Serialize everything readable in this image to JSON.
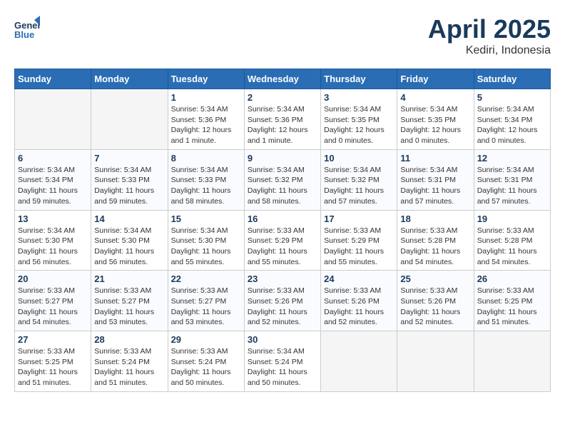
{
  "header": {
    "logo_line1": "General",
    "logo_line2": "Blue",
    "month_year": "April 2025",
    "location": "Kediri, Indonesia"
  },
  "weekdays": [
    "Sunday",
    "Monday",
    "Tuesday",
    "Wednesday",
    "Thursday",
    "Friday",
    "Saturday"
  ],
  "weeks": [
    [
      {
        "day": "",
        "info": ""
      },
      {
        "day": "",
        "info": ""
      },
      {
        "day": "1",
        "info": "Sunrise: 5:34 AM\nSunset: 5:36 PM\nDaylight: 12 hours\nand 1 minute."
      },
      {
        "day": "2",
        "info": "Sunrise: 5:34 AM\nSunset: 5:36 PM\nDaylight: 12 hours\nand 1 minute."
      },
      {
        "day": "3",
        "info": "Sunrise: 5:34 AM\nSunset: 5:35 PM\nDaylight: 12 hours\nand 0 minutes."
      },
      {
        "day": "4",
        "info": "Sunrise: 5:34 AM\nSunset: 5:35 PM\nDaylight: 12 hours\nand 0 minutes."
      },
      {
        "day": "5",
        "info": "Sunrise: 5:34 AM\nSunset: 5:34 PM\nDaylight: 12 hours\nand 0 minutes."
      }
    ],
    [
      {
        "day": "6",
        "info": "Sunrise: 5:34 AM\nSunset: 5:34 PM\nDaylight: 11 hours\nand 59 minutes."
      },
      {
        "day": "7",
        "info": "Sunrise: 5:34 AM\nSunset: 5:33 PM\nDaylight: 11 hours\nand 59 minutes."
      },
      {
        "day": "8",
        "info": "Sunrise: 5:34 AM\nSunset: 5:33 PM\nDaylight: 11 hours\nand 58 minutes."
      },
      {
        "day": "9",
        "info": "Sunrise: 5:34 AM\nSunset: 5:32 PM\nDaylight: 11 hours\nand 58 minutes."
      },
      {
        "day": "10",
        "info": "Sunrise: 5:34 AM\nSunset: 5:32 PM\nDaylight: 11 hours\nand 57 minutes."
      },
      {
        "day": "11",
        "info": "Sunrise: 5:34 AM\nSunset: 5:31 PM\nDaylight: 11 hours\nand 57 minutes."
      },
      {
        "day": "12",
        "info": "Sunrise: 5:34 AM\nSunset: 5:31 PM\nDaylight: 11 hours\nand 57 minutes."
      }
    ],
    [
      {
        "day": "13",
        "info": "Sunrise: 5:34 AM\nSunset: 5:30 PM\nDaylight: 11 hours\nand 56 minutes."
      },
      {
        "day": "14",
        "info": "Sunrise: 5:34 AM\nSunset: 5:30 PM\nDaylight: 11 hours\nand 56 minutes."
      },
      {
        "day": "15",
        "info": "Sunrise: 5:34 AM\nSunset: 5:30 PM\nDaylight: 11 hours\nand 55 minutes."
      },
      {
        "day": "16",
        "info": "Sunrise: 5:33 AM\nSunset: 5:29 PM\nDaylight: 11 hours\nand 55 minutes."
      },
      {
        "day": "17",
        "info": "Sunrise: 5:33 AM\nSunset: 5:29 PM\nDaylight: 11 hours\nand 55 minutes."
      },
      {
        "day": "18",
        "info": "Sunrise: 5:33 AM\nSunset: 5:28 PM\nDaylight: 11 hours\nand 54 minutes."
      },
      {
        "day": "19",
        "info": "Sunrise: 5:33 AM\nSunset: 5:28 PM\nDaylight: 11 hours\nand 54 minutes."
      }
    ],
    [
      {
        "day": "20",
        "info": "Sunrise: 5:33 AM\nSunset: 5:27 PM\nDaylight: 11 hours\nand 54 minutes."
      },
      {
        "day": "21",
        "info": "Sunrise: 5:33 AM\nSunset: 5:27 PM\nDaylight: 11 hours\nand 53 minutes."
      },
      {
        "day": "22",
        "info": "Sunrise: 5:33 AM\nSunset: 5:27 PM\nDaylight: 11 hours\nand 53 minutes."
      },
      {
        "day": "23",
        "info": "Sunrise: 5:33 AM\nSunset: 5:26 PM\nDaylight: 11 hours\nand 52 minutes."
      },
      {
        "day": "24",
        "info": "Sunrise: 5:33 AM\nSunset: 5:26 PM\nDaylight: 11 hours\nand 52 minutes."
      },
      {
        "day": "25",
        "info": "Sunrise: 5:33 AM\nSunset: 5:26 PM\nDaylight: 11 hours\nand 52 minutes."
      },
      {
        "day": "26",
        "info": "Sunrise: 5:33 AM\nSunset: 5:25 PM\nDaylight: 11 hours\nand 51 minutes."
      }
    ],
    [
      {
        "day": "27",
        "info": "Sunrise: 5:33 AM\nSunset: 5:25 PM\nDaylight: 11 hours\nand 51 minutes."
      },
      {
        "day": "28",
        "info": "Sunrise: 5:33 AM\nSunset: 5:24 PM\nDaylight: 11 hours\nand 51 minutes."
      },
      {
        "day": "29",
        "info": "Sunrise: 5:33 AM\nSunset: 5:24 PM\nDaylight: 11 hours\nand 50 minutes."
      },
      {
        "day": "30",
        "info": "Sunrise: 5:34 AM\nSunset: 5:24 PM\nDaylight: 11 hours\nand 50 minutes."
      },
      {
        "day": "",
        "info": ""
      },
      {
        "day": "",
        "info": ""
      },
      {
        "day": "",
        "info": ""
      }
    ]
  ]
}
